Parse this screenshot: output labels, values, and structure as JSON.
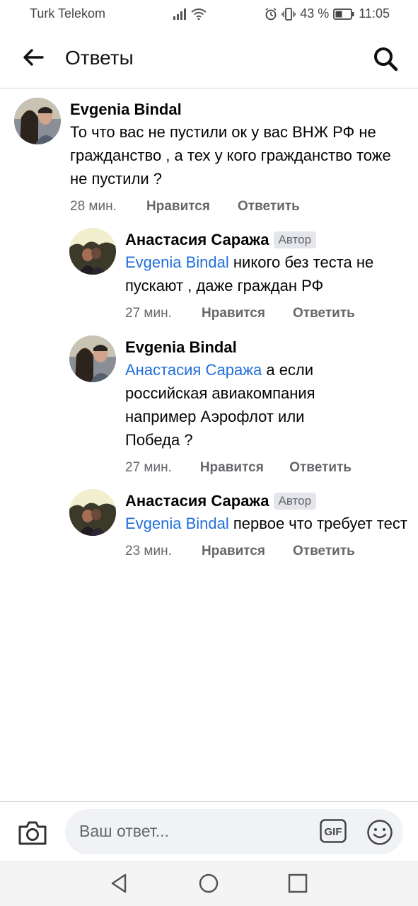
{
  "status_bar": {
    "carrier": "Turk Telekom",
    "battery": "43 %",
    "time": "11:05"
  },
  "header": {
    "title": "Ответы"
  },
  "comments": [
    {
      "author": "Evgenia Bindal",
      "badge": "",
      "mention": "",
      "text": "То что вас не пустили ок у вас ВНЖ РФ не гражданство , а тех у кого гражданство тоже не пустили ?",
      "time": "28 мин.",
      "like": "Нравится",
      "reply": "Ответить"
    },
    {
      "author": "Анастасия Саража",
      "badge": "Автор",
      "mention": "Evgenia Bindal",
      "text": " никого без теста не пускают , даже граждан РФ",
      "time": "27 мин.",
      "like": "Нравится",
      "reply": "Ответить"
    },
    {
      "author": "Evgenia Bindal",
      "badge": "",
      "mention": "Анастасия Саража",
      "text": " а если российская авиакомпания например Аэрофлот или Победа ?",
      "time": "27 мин.",
      "like": "Нравится",
      "reply": "Ответить"
    },
    {
      "author": "Анастасия Саража",
      "badge": "Автор",
      "mention": "Evgenia Bindal",
      "text": " первое что требует тест",
      "time": "23 мин.",
      "like": "Нравится",
      "reply": "Ответить"
    }
  ],
  "composer": {
    "placeholder": "Ваш ответ...",
    "gif_label": "GIF"
  },
  "colors": {
    "mention": "#216fdb",
    "meta": "#65676b"
  }
}
